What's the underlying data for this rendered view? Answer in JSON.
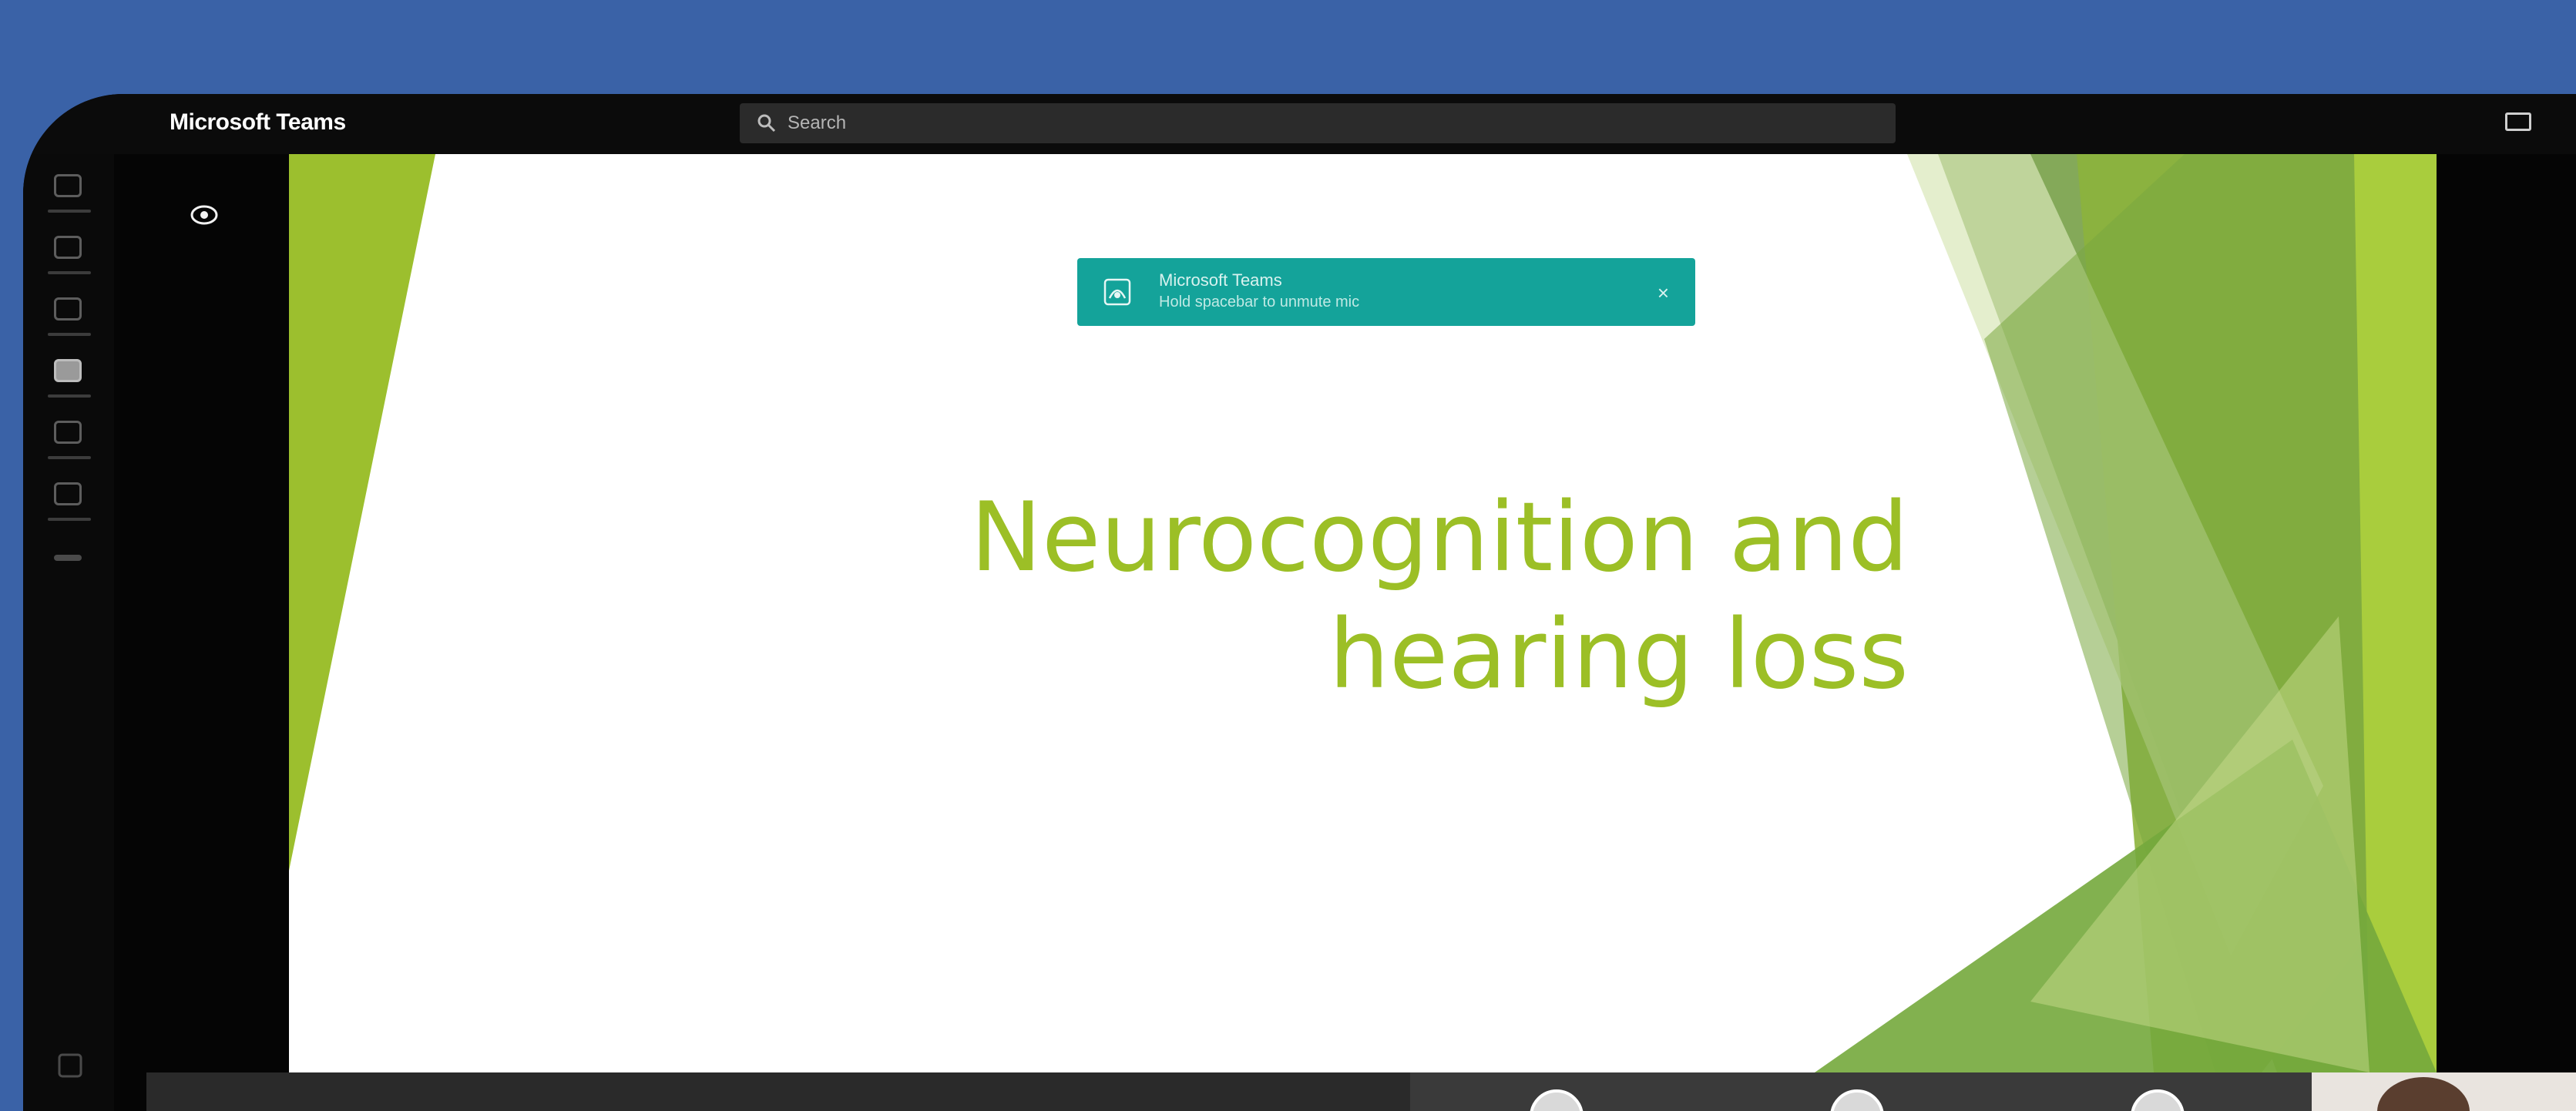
{
  "app": {
    "title": "Microsoft Teams"
  },
  "search": {
    "placeholder": "Search"
  },
  "toast": {
    "title": "Microsoft Teams",
    "message": "Hold spacebar to unmute mic",
    "close_glyph": "×"
  },
  "slide": {
    "title_line1": "Neurocognition and",
    "title_line2": "hearing loss"
  },
  "colors": {
    "background": "#3a62a7",
    "slide_accent": "#9cbf26",
    "toast": "#14a39a"
  },
  "rail": {
    "items": [
      {
        "icon": "activity-icon"
      },
      {
        "icon": "chat-icon"
      },
      {
        "icon": "teams-icon"
      },
      {
        "icon": "calendar-icon"
      },
      {
        "icon": "calls-icon"
      },
      {
        "icon": "files-icon"
      },
      {
        "icon": "more-icon"
      }
    ]
  }
}
